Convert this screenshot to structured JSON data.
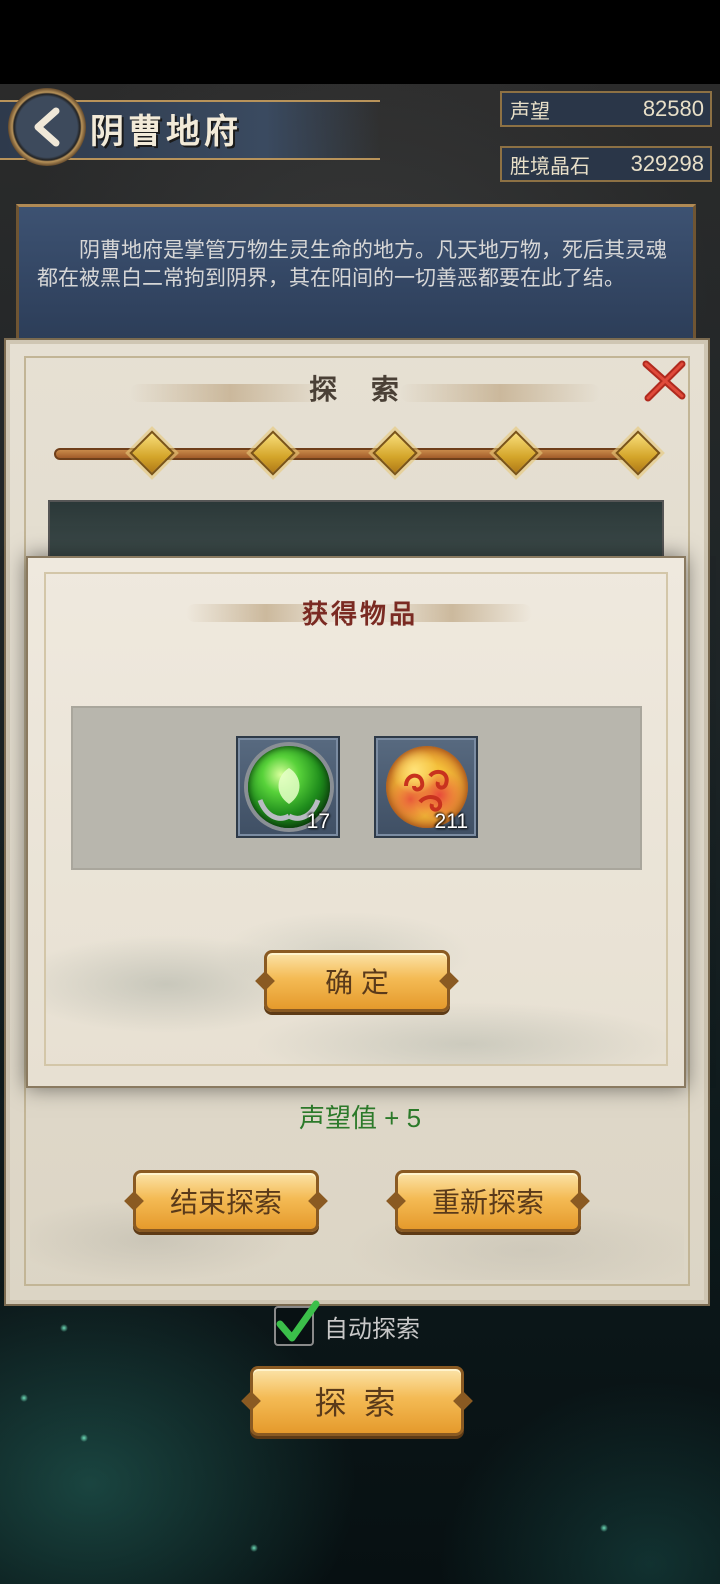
{
  "header": {
    "title": "阴曹地府",
    "stats": [
      {
        "label": "声望",
        "value": "82580"
      },
      {
        "label": "胜境晶石",
        "value": "329298"
      }
    ]
  },
  "description": "阴曹地府是掌管万物生灵生命的地方。凡天地万物，死后其灵魂都在被黑白二常拘到阴界，其在阳间的一切善恶都要在此了结。",
  "explore_panel": {
    "title": "探  索",
    "progress_nodes": 5,
    "reward_text": "声望值 + 5",
    "end_button": "结束探索",
    "restart_button": "重新探索"
  },
  "popup": {
    "title": "获得物品",
    "items": [
      {
        "icon": "green-spirit-orb-icon",
        "count": "17"
      },
      {
        "icon": "golden-cloud-orb-icon",
        "count": "211"
      }
    ],
    "confirm_button": "确  定"
  },
  "auto_explore": {
    "label": "自动探索",
    "checked": true
  },
  "explore_button": "探  索",
  "colors": {
    "accent_gold": "#f4bb55",
    "reward_green": "#2c7a2a",
    "title_red": "#7a2a22"
  }
}
